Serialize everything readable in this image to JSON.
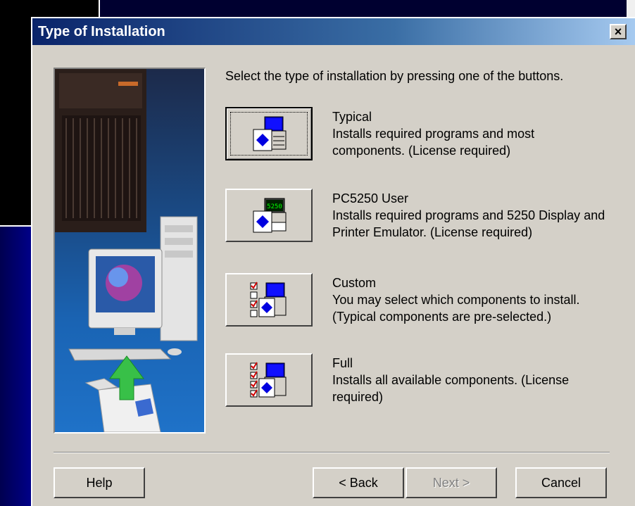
{
  "dialog": {
    "title": "Type of Installation",
    "close_label": "×",
    "instruction": "Select the type of installation by pressing one of the buttons."
  },
  "options": [
    {
      "name": "Typical",
      "description": [
        "Installs required programs and most",
        "components.  (License required)"
      ],
      "icon": "typical-install-icon",
      "focused": true
    },
    {
      "name": "PC5250 User",
      "description": [
        "Installs required programs and 5250 Display and",
        "Printer Emulator.  (License required)"
      ],
      "icon": "pc5250-install-icon",
      "icon_text": "5250"
    },
    {
      "name": "Custom",
      "description": [
        "You may select which components to install.",
        "(Typical components are pre-selected.)"
      ],
      "icon": "custom-install-icon"
    },
    {
      "name": "Full",
      "description": [
        "Installs all available components.  (License",
        "required)"
      ],
      "icon": "full-install-icon"
    }
  ],
  "footer": {
    "help_label": "Help",
    "back_label": "< Back",
    "next_label": "Next >",
    "next_disabled": true,
    "cancel_label": "Cancel"
  },
  "colors": {
    "titlebar_start": "#0a246a",
    "titlebar_end": "#a6caf0",
    "dialog_bg": "#d4d0c8",
    "backdrop": "#000030"
  }
}
